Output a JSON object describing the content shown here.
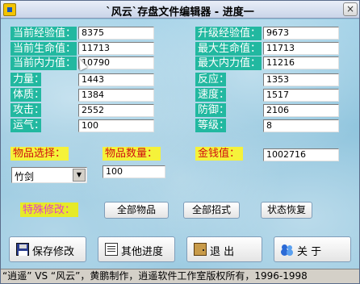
{
  "window": {
    "title": "`风云`存盘文件编辑器 - 进度一",
    "close_glyph": "×"
  },
  "stats_left": [
    {
      "label": "当前经验值：",
      "value": "8375"
    },
    {
      "label": "当前生命值：",
      "value": "11713"
    },
    {
      "label": "当前内力值：",
      "value": "10790"
    },
    {
      "label": "力量：",
      "value": "1443"
    },
    {
      "label": "体质：",
      "value": "1384"
    },
    {
      "label": "攻击：",
      "value": "2552"
    },
    {
      "label": "运气：",
      "value": "100"
    }
  ],
  "stats_right": [
    {
      "label": "升级经验值：",
      "value": "9673"
    },
    {
      "label": "最大生命值：",
      "value": "11713"
    },
    {
      "label": "最大内力值：",
      "value": "11216"
    },
    {
      "label": "反应：",
      "value": "1353"
    },
    {
      "label": "速度：",
      "value": "1517"
    },
    {
      "label": "防御：",
      "value": "2106"
    },
    {
      "label": "等级：",
      "value": "8"
    }
  ],
  "items": {
    "select_label": "物品选择：",
    "selected_item": "竹剑",
    "quantity_label": "物品数量：",
    "quantity_value": "100",
    "money_label": "金钱值：",
    "money_value": "1002716"
  },
  "special": {
    "label": "特殊修改：",
    "all_items_button": "全部物品",
    "all_moves_button": "全部招式",
    "restore_button": "状态恢复"
  },
  "bottom_buttons": {
    "save": "保存修改",
    "other_progress": "其他进度",
    "exit": "退  出",
    "about": "关  于"
  },
  "status_bar": "“逍遥” VS “风云”，黄鹏制作，逍遥软件工作室版权所有，1996-1998",
  "colors": {
    "label_bg": "#22b8a0",
    "highlight_label_bg": "#f5f23a",
    "highlight_label_text": "#d01010",
    "special_label_text": "#e040c8"
  }
}
